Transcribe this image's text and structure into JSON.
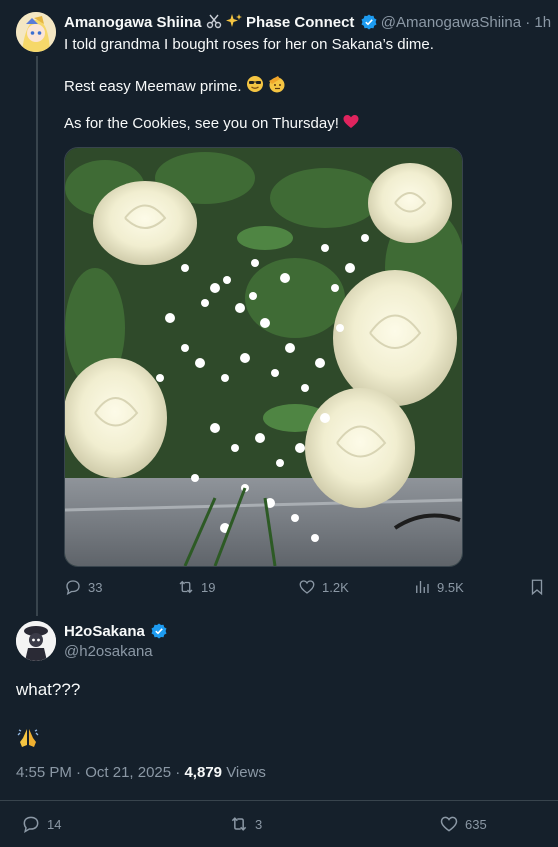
{
  "tweet": {
    "author_name": "Amanogawa Shiina",
    "author_tag": "Phase Connect",
    "handle": "@AmanogawaShiina",
    "time_ago": "1h",
    "line1": "I told grandma I bought roses for her on Sakana’s dime.",
    "line2": "Rest easy Meemaw prime.",
    "line3": "As for the Cookies, see you on Thursday!",
    "replies": "33",
    "reposts": "19",
    "likes": "1.2K",
    "views": "9.5K",
    "media_icon_names": [
      "bouquet-photo"
    ]
  },
  "reply": {
    "author_name": "H2oSakana",
    "handle": "@h2osakana",
    "text": "what???",
    "time": "4:55 PM",
    "date": "Oct 21, 2025",
    "views_count": "4,879",
    "views_label": "Views",
    "replies": "14",
    "reposts": "3",
    "likes": "635"
  },
  "colors": {
    "background": "#15202b",
    "text": "#f7f9f9",
    "muted": "#8b98a5",
    "verified": "#1d9bf0",
    "heart": "#e0245e"
  },
  "separators": {
    "dot": "·"
  }
}
